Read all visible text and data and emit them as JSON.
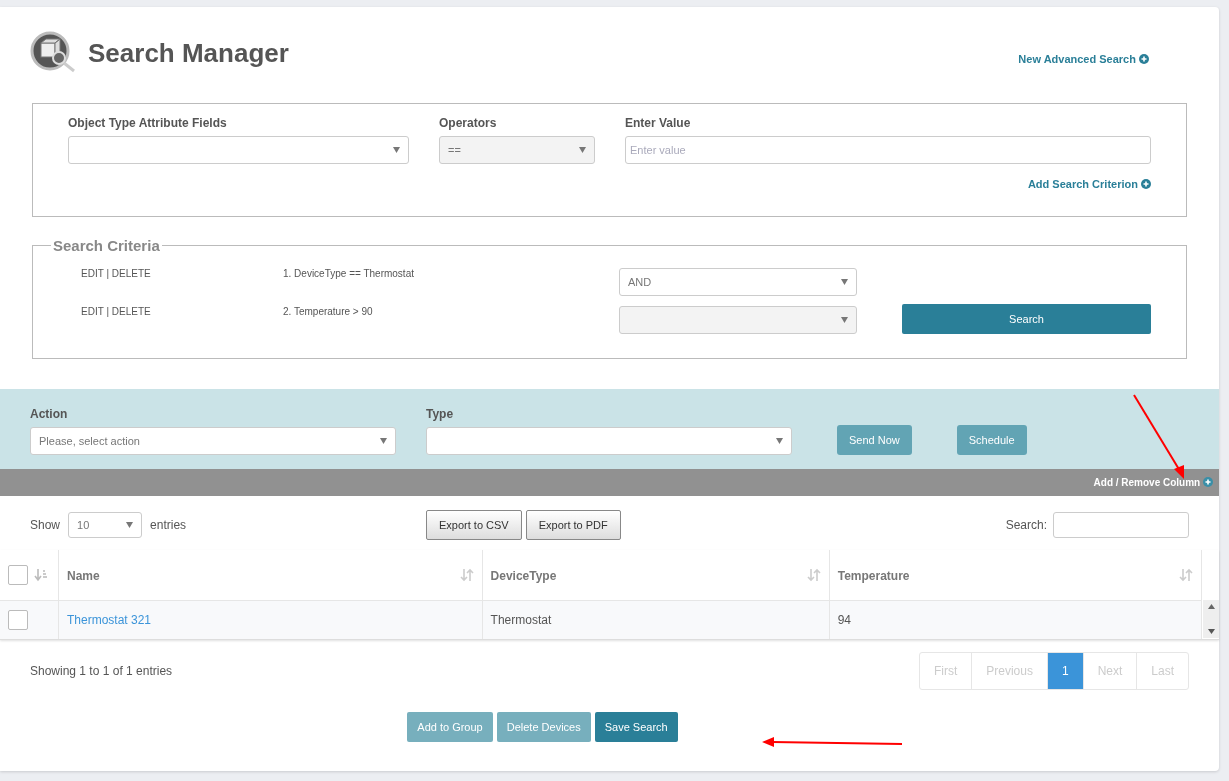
{
  "header": {
    "title": "Search Manager",
    "link": "New Advanced Search"
  },
  "criterion_form": {
    "fields": [
      {
        "label": "Object Type Attribute Fields",
        "kind": "select",
        "disabled": false
      },
      {
        "label": "Operators",
        "kind": "select",
        "value": "==",
        "disabled": true
      },
      {
        "label": "Enter Value",
        "kind": "input",
        "placeholder": "Enter value"
      }
    ],
    "link": "Add Search Criterion"
  },
  "criteria": {
    "title": "Search Criteria",
    "rows": [
      {
        "actions": "EDIT | DELETE",
        "text": "1. DeviceType == Thermostat",
        "operator": "AND",
        "disabled": false
      },
      {
        "actions": "EDIT | DELETE",
        "text": "2. Temperature > 90",
        "operator": "",
        "disabled": true
      }
    ],
    "search_button": "Search"
  },
  "action_bar": {
    "fields": [
      {
        "label": "Action",
        "placeholder": "Please, select action"
      },
      {
        "label": "Type"
      }
    ],
    "buttons": [
      {
        "label": "Send Now",
        "disabled": true
      },
      {
        "label": "Schedule",
        "disabled": true
      }
    ]
  },
  "column_bar": {
    "link": "Add / Remove Column"
  },
  "table_tools": {
    "show": "Show",
    "page_size": "10",
    "entries": "entries",
    "exports": [
      "Export to CSV",
      "Export to PDF"
    ],
    "search_label": "Search:"
  },
  "table": {
    "select_all": {
      "checked": false
    },
    "columns": [
      "Name",
      "DeviceType",
      "Temperature"
    ],
    "rows": [
      {
        "checked": false,
        "cells": [
          "Thermostat 321",
          "Thermostat",
          "94"
        ]
      }
    ]
  },
  "info": "Showing 1 to 1 of 1 entries",
  "pagination": [
    {
      "label": "First",
      "selected": false,
      "disabled": true
    },
    {
      "label": "Previous",
      "selected": false,
      "disabled": true
    },
    {
      "label": "1",
      "selected": true,
      "disabled": false
    },
    {
      "label": "Next",
      "selected": false,
      "disabled": true
    },
    {
      "label": "Last",
      "selected": false,
      "disabled": true
    }
  ],
  "footer_buttons": [
    {
      "label": "Add to Group",
      "disabled": true
    },
    {
      "label": "Delete Devices",
      "disabled": true
    },
    {
      "label": "Save Search",
      "disabled": false
    }
  ]
}
